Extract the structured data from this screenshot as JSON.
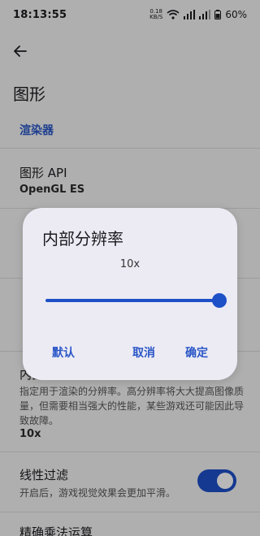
{
  "status_bar": {
    "time": "18:13:55",
    "net_speed_value": "0.18",
    "net_speed_unit": "KB/S",
    "battery": "60%"
  },
  "header": {
    "back_icon": "arrow-left-icon",
    "title": "图形"
  },
  "section": {
    "header": "渲染器"
  },
  "settings": {
    "api_title": "图形 API",
    "api_value": "OpenGL ES",
    "resolution_title": "内部分辨率",
    "resolution_desc": "指定用于渲染的分辨率。高分辨率将大大提高图像质量，但需要相当强大的性能，某些游戏还可能因此导致故障。",
    "resolution_value": "10x",
    "linear_filter_title": "线性过滤",
    "linear_filter_desc": "开启后，游戏视觉效果会更加平滑。",
    "linear_filter_on": true,
    "next_title": "精确乘法运算"
  },
  "dialog": {
    "title": "内部分辨率",
    "value": "10x",
    "slider_fraction": 1.0,
    "default_label": "默认",
    "cancel_label": "取消",
    "ok_label": "确定"
  },
  "colors": {
    "accent": "#1e50c8",
    "section": "#2a56c7",
    "dialog_bg": "#ecebf4"
  }
}
